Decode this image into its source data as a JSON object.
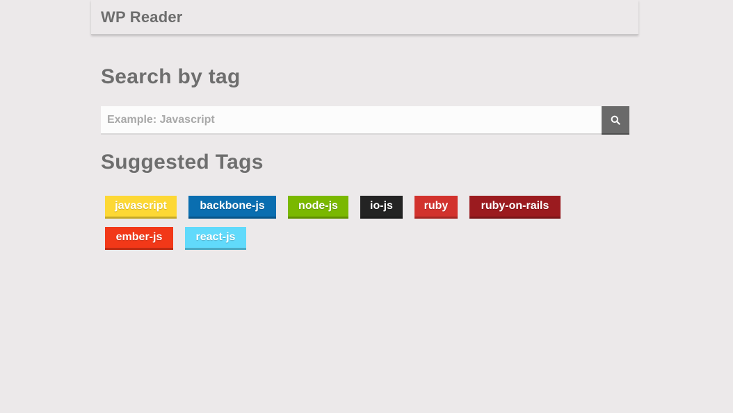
{
  "header": {
    "title": "WP Reader"
  },
  "search": {
    "heading": "Search by tag",
    "placeholder": "Example: Javascript",
    "value": ""
  },
  "suggested": {
    "heading": "Suggested Tags",
    "tags": [
      {
        "label": "javascript",
        "color": "#fdd835"
      },
      {
        "label": "backbone-js",
        "color": "#0a6eb0"
      },
      {
        "label": "node-js",
        "color": "#7ab800"
      },
      {
        "label": "io-js",
        "color": "#232323"
      },
      {
        "label": "ruby",
        "color": "#d2322d"
      },
      {
        "label": "ruby-on-rails",
        "color": "#9b1b1f"
      },
      {
        "label": "ember-js",
        "color": "#f23818"
      },
      {
        "label": "react-js",
        "color": "#61dafb"
      }
    ]
  },
  "icons": {
    "search_button": "search-icon"
  }
}
